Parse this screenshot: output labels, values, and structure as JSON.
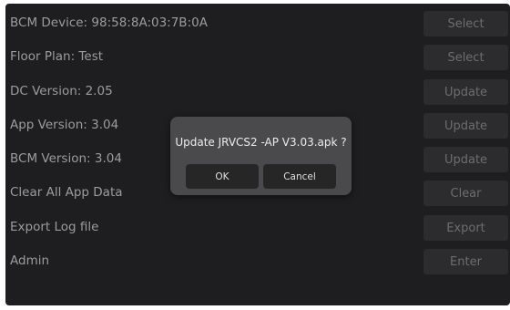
{
  "settings": {
    "rows": [
      {
        "label": "BCM Device: 98:58:8A:03:7B:0A",
        "button": "Select"
      },
      {
        "label": "Floor Plan:  Test",
        "button": "Select"
      },
      {
        "label": "DC Version:  2.05",
        "button": "Update"
      },
      {
        "label": "App Version:  3.04",
        "button": "Update"
      },
      {
        "label": "BCM Version:  3.04",
        "button": "Update"
      },
      {
        "label": "Clear All App Data",
        "button": "Clear"
      },
      {
        "label": "Export Log file",
        "button": "Export"
      },
      {
        "label": "Admin",
        "button": "Enter"
      }
    ]
  },
  "dialog": {
    "message": "Update JRVCS2  -AP V3.03.apk ?",
    "ok_label": "OK",
    "cancel_label": "Cancel"
  }
}
